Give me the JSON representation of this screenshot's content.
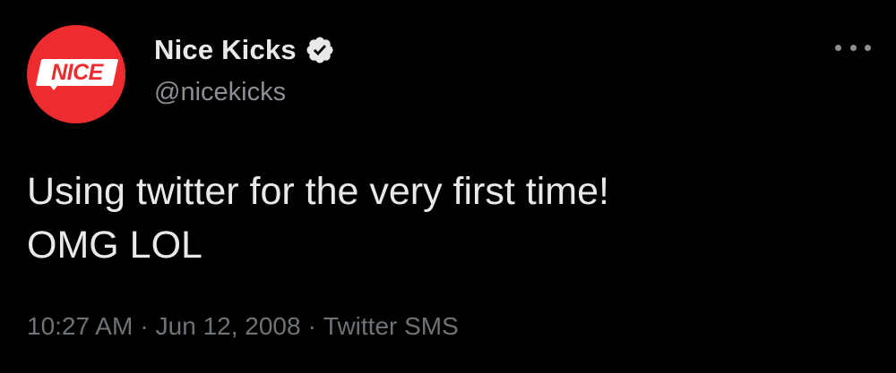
{
  "account": {
    "avatar_text": "NICE",
    "display_name": "Nice Kicks",
    "verified_icon": "verified-badge-icon",
    "handle": "@nicekicks"
  },
  "tweet": {
    "lines": [
      "Using twitter for the very first time!",
      "OMG LOL"
    ]
  },
  "meta": {
    "time": "10:27 AM",
    "separator": "·",
    "date": "Jun 12, 2008",
    "source": "Twitter SMS"
  },
  "menu": {
    "icon": "more-options-icon"
  },
  "colors": {
    "background": "#000000",
    "primary_text": "#e7e9ea",
    "secondary_text": "#8b8f94",
    "meta_text": "#6e7378",
    "avatar_red": "#ee2b2f"
  }
}
